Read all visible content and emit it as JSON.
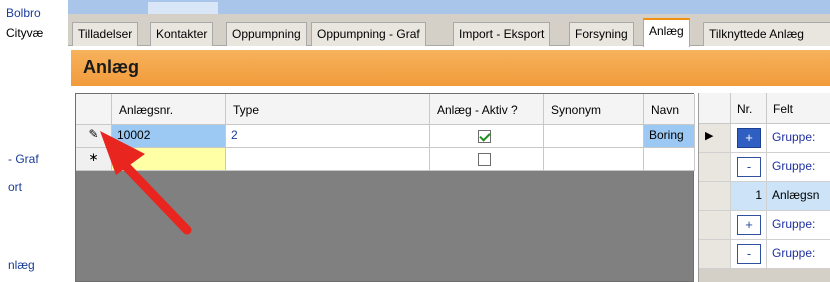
{
  "left_nav": {
    "items": [
      "Bolbro",
      "Cityvæ",
      "- Graf",
      "ort",
      "nlæg"
    ]
  },
  "tabs": [
    {
      "label": "Tilladelser"
    },
    {
      "label": "Kontakter"
    },
    {
      "label": "Oppumpning"
    },
    {
      "label": "Oppumpning - Graf"
    },
    {
      "label": "Import - Eksport"
    },
    {
      "label": "Forsyning"
    },
    {
      "label": "Anlæg",
      "active": true
    },
    {
      "label": "Tilknyttede Anlæg"
    }
  ],
  "section_title": "Anlæg",
  "grid": {
    "columns": [
      "Anlægsnr.",
      "Type",
      "Anlæg - Aktiv ?",
      "Synonym",
      "Navn"
    ],
    "rows": [
      {
        "indicator": "✎",
        "anlaegsnr": "10002",
        "type": "2",
        "aktiv": true,
        "synonym": "",
        "navn": "Boring"
      },
      {
        "indicator": "∗",
        "anlaegsnr": "",
        "type": "",
        "aktiv": false,
        "synonym": "",
        "navn": ""
      }
    ]
  },
  "right_grid": {
    "columns": [
      "Nr.",
      "Felt"
    ],
    "rows": [
      {
        "expander": "+",
        "nr": "",
        "felt": "Gruppe:",
        "current": true
      },
      {
        "expander": "-",
        "nr": "",
        "felt": "Gruppe:"
      },
      {
        "expander": "",
        "nr": "1",
        "felt": "Anlægsn"
      },
      {
        "expander": "+",
        "nr": "",
        "felt": "Gruppe:"
      },
      {
        "expander": "-",
        "nr": "",
        "felt": "Gruppe:"
      }
    ]
  },
  "colors": {
    "header_orange": "#f19b3b",
    "annotation_arrow": "#e8251f",
    "selected_cell": "#9cc9f3",
    "new_row_cell": "#ffffa6"
  }
}
